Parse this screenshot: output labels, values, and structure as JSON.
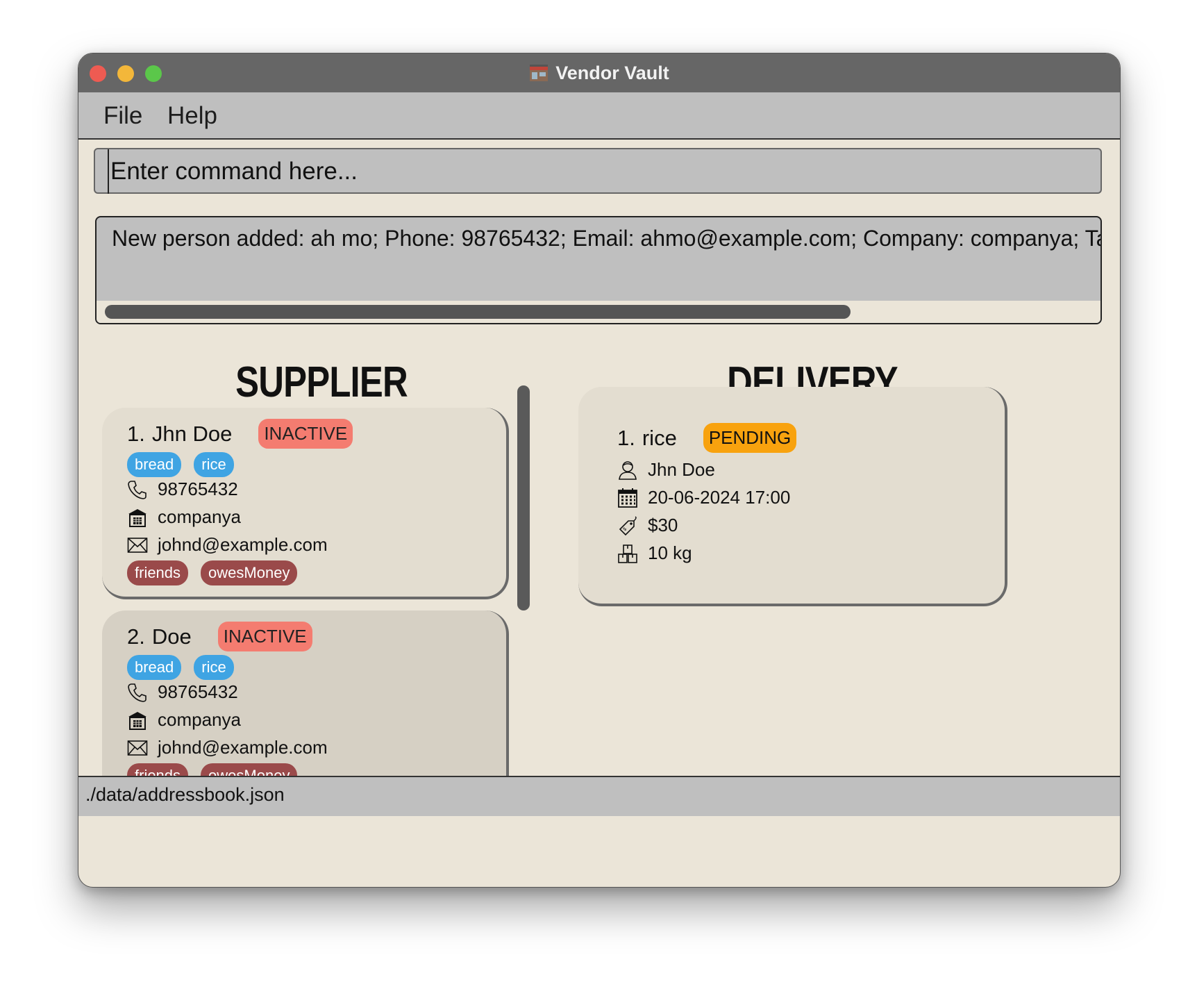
{
  "window": {
    "title": "Vendor Vault"
  },
  "menu": {
    "file": "File",
    "help": "Help"
  },
  "command": {
    "placeholder": "Enter command here..."
  },
  "result": {
    "text": "New person added: ah mo; Phone: 98765432; Email: ahmo@example.com; Company: companya; Tags: [friends]"
  },
  "supplier_list": {
    "heading": "SUPPLIER LIST",
    "items": [
      {
        "index": "1.",
        "name": "Jhn Doe",
        "status": "INACTIVE",
        "products": [
          "bread",
          "rice"
        ],
        "phone": "98765432",
        "company": "companya",
        "email": "johnd@example.com",
        "tags": [
          "friends",
          "owesMoney"
        ]
      },
      {
        "index": "2.",
        "name": "Doe",
        "status": "INACTIVE",
        "products": [
          "bread",
          "rice"
        ],
        "phone": "98765432",
        "company": "companya",
        "email": "johnd@example.com",
        "tags": [
          "friends",
          "owesMoney"
        ]
      }
    ]
  },
  "delivery_list": {
    "heading": "DELIVERY LIST",
    "items": [
      {
        "index": "1.",
        "product": "rice",
        "status": "PENDING",
        "supplier": "Jhn Doe",
        "datetime": "20-06-2024 17:00",
        "cost": "$30",
        "quantity": "10 kg"
      }
    ]
  },
  "status_bar": {
    "path": "./data/addressbook.json"
  },
  "colors": {
    "inactive_badge": "#f47c70",
    "pending_badge": "#f8a20e",
    "product_chip": "#3fa4e3",
    "tag_chip": "#9a4a4a",
    "background": "#ebe5d8"
  }
}
